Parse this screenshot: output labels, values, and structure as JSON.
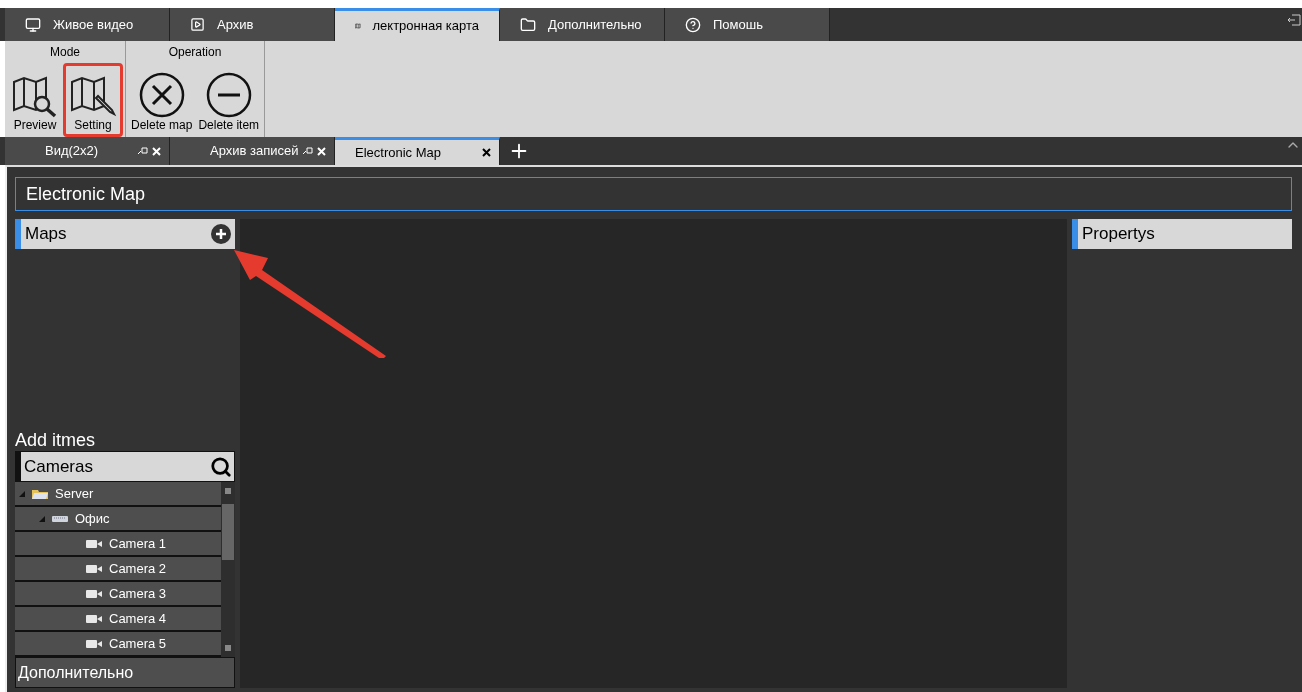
{
  "main_tabs": [
    {
      "label": "Живое видео",
      "selected": false
    },
    {
      "label": "Архив",
      "selected": false
    },
    {
      "label": "лектронная карта",
      "selected": true
    },
    {
      "label": "Дополнительно",
      "selected": false
    },
    {
      "label": "Помошь",
      "selected": false
    }
  ],
  "ribbon": [
    {
      "title": "Mode",
      "buttons": [
        {
          "label": "Preview",
          "highlighted": false
        },
        {
          "label": "Setting",
          "highlighted": true
        }
      ]
    },
    {
      "title": "Operation",
      "buttons": [
        {
          "label": "Delete map",
          "highlighted": false
        },
        {
          "label": "Delete item",
          "highlighted": false
        }
      ]
    }
  ],
  "doc_tabs": [
    {
      "label": "Вид(2x2)",
      "pinnable": true,
      "selected": false
    },
    {
      "label": "Архив записей",
      "pinnable": true,
      "selected": false
    },
    {
      "label": "Electronic Map",
      "pinnable": false,
      "selected": true
    }
  ],
  "page_title": "Electronic Map",
  "maps_panel": {
    "title": "Maps"
  },
  "properties_panel": {
    "title": "Propertys"
  },
  "add_items": {
    "title": "Add itmes",
    "search_label": "Cameras",
    "tree": [
      {
        "label": "Server",
        "kind": "server",
        "expanded": true,
        "children": [
          {
            "label": "Офис",
            "kind": "device",
            "expanded": true,
            "children": [
              {
                "label": "Camera 1",
                "kind": "camera"
              },
              {
                "label": "Camera 2",
                "kind": "camera"
              },
              {
                "label": "Camera 3",
                "kind": "camera"
              },
              {
                "label": "Camera 4",
                "kind": "camera"
              },
              {
                "label": "Camera 5",
                "kind": "camera"
              }
            ]
          }
        ]
      }
    ]
  },
  "bottom_section": "Дополнительно"
}
